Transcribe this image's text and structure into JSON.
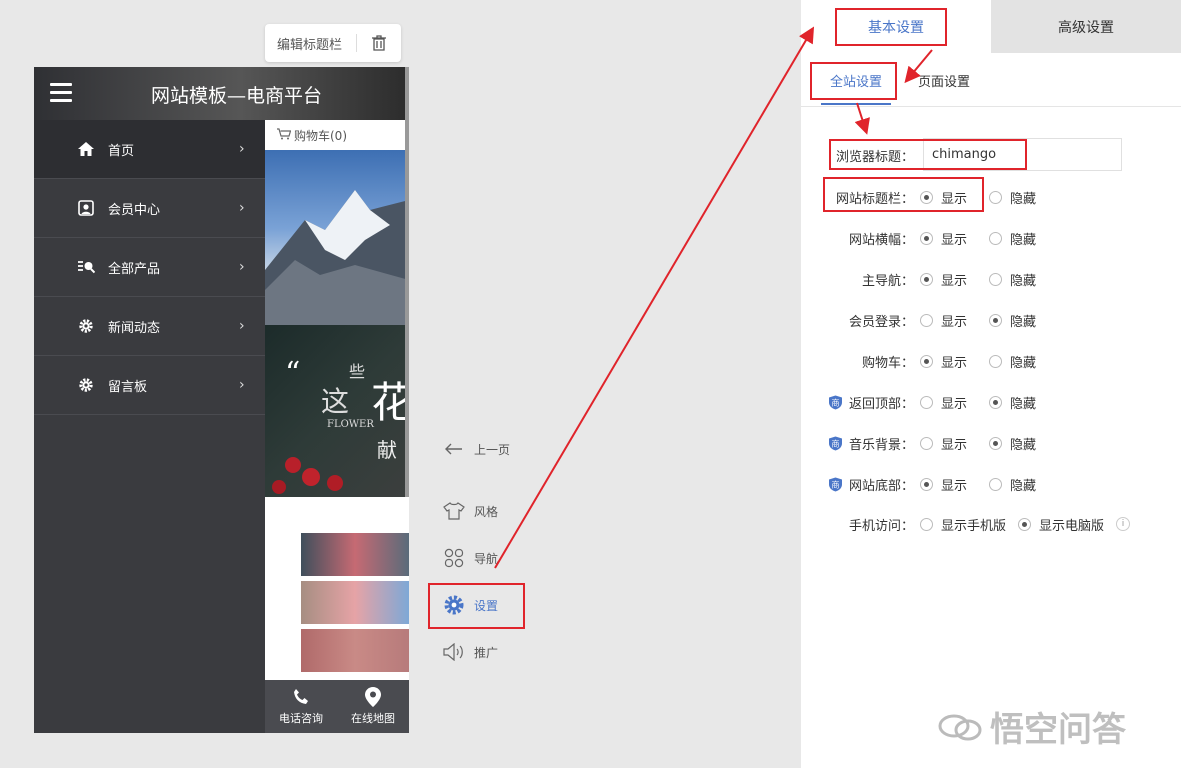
{
  "edit_bar": {
    "label": "编辑标题栏",
    "icon": "trash-icon"
  },
  "phone": {
    "title": "网站模板—电商平台",
    "menu": [
      {
        "label": "首页",
        "icon": "home-icon"
      },
      {
        "label": "会员中心",
        "icon": "member-icon"
      },
      {
        "label": "全部产品",
        "icon": "products-icon"
      },
      {
        "label": "新闻动态",
        "icon": "gear-icon"
      },
      {
        "label": "留言板",
        "icon": "gear-icon"
      }
    ],
    "cart": "购物车(0)",
    "banner_text": {
      "quote": "“",
      "small": "些",
      "big1": "这",
      "big2": "花",
      "latin": "FLOWER",
      "line2": "献"
    },
    "bottom_nav": [
      {
        "label": "电话咨询",
        "icon": "phone-icon"
      },
      {
        "label": "在线地图",
        "icon": "map-pin-icon"
      }
    ]
  },
  "toolbar": {
    "back": "上一页",
    "style": "风格",
    "nav": "导航",
    "settings": "设置",
    "promote": "推广"
  },
  "panel": {
    "tabs": {
      "basic": "基本设置",
      "advanced": "高级设置"
    },
    "subtabs": {
      "global": "全站设置",
      "page": "页面设置"
    },
    "browser_title_label": "浏览器标题：",
    "browser_title_value": "chimango",
    "show": "显示",
    "hide": "隐藏",
    "rows": [
      {
        "label": "网站标题栏：",
        "selected": "show"
      },
      {
        "label": "网站横幅：",
        "selected": "show"
      },
      {
        "label": "主导航：",
        "selected": "show"
      },
      {
        "label": "会员登录：",
        "selected": "hide"
      },
      {
        "label": "购物车：",
        "selected": "show"
      },
      {
        "label": "返回顶部：",
        "selected": "hide",
        "badge": "商"
      },
      {
        "label": "音乐背景：",
        "selected": "hide",
        "badge": "商"
      },
      {
        "label": "网站底部：",
        "selected": "show",
        "badge": "商"
      }
    ],
    "mobile": {
      "label": "手机访问：",
      "opt1": "显示手机版",
      "opt2": "显示电脑版",
      "selected": "opt2",
      "info": "i"
    }
  },
  "watermark": "悟空问答",
  "colors": {
    "accent": "#4a76c8",
    "highlight": "#e0242b",
    "menu_bg": "#3a3b3f"
  }
}
